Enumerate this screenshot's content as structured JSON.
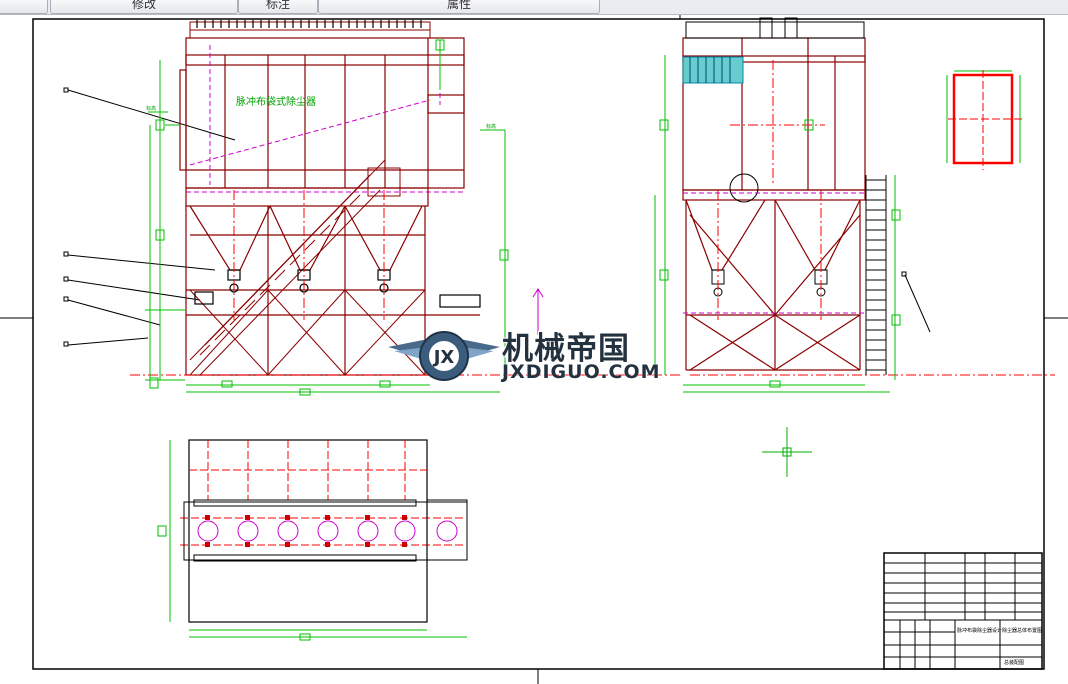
{
  "toolbar": {
    "tabs": [
      {
        "label": ""
      },
      {
        "label": "修改"
      },
      {
        "label": "标注"
      },
      {
        "label": "属性"
      }
    ]
  },
  "drawing": {
    "plate_label": "脉冲布袋式除尘器",
    "level_labels": [
      "标高",
      "标高"
    ],
    "title_block": {
      "design_unit": "脉冲布袋除尘器设计",
      "project": "除尘器总体布置图",
      "drawing_no": "总装配图"
    }
  },
  "watermark": {
    "cn": "机械帝国",
    "en": "JXDIGUO.COM"
  },
  "colors": {
    "frame": "#000000",
    "dimension": "#00c000",
    "structure": "#8b0000",
    "centerline": "#ff0000",
    "hidden": "#cc00cc",
    "accent": "#00cccc"
  }
}
